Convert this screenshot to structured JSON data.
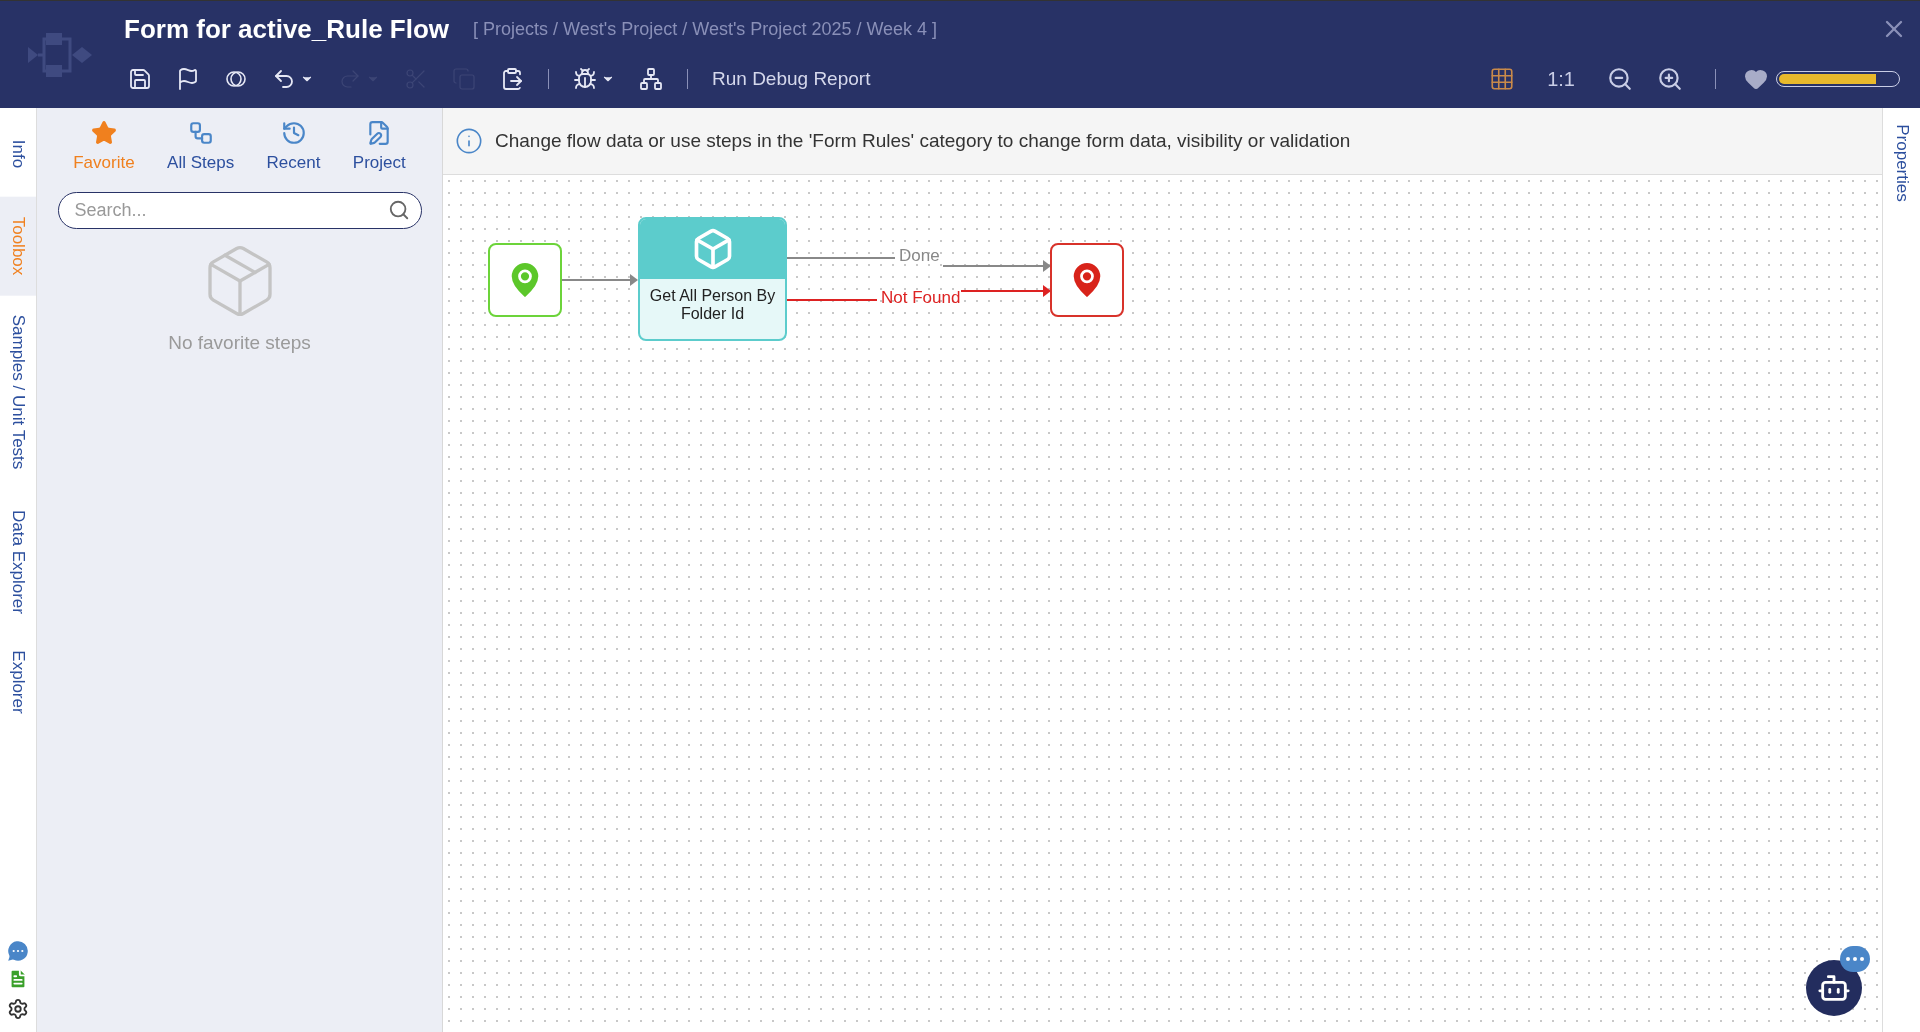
{
  "window": {
    "title": "Form for active_Rule Flow",
    "breadcrumb": "[ Projects / West's Project / West's Project 2025 / Week 4 ]"
  },
  "toolbar": {
    "tools": [
      {
        "kind": "save",
        "disabled": false,
        "dropdown": false
      },
      {
        "kind": "flag",
        "disabled": false,
        "dropdown": false
      },
      {
        "kind": "overlap",
        "disabled": false,
        "dropdown": false
      },
      {
        "kind": "undo",
        "disabled": false,
        "dropdown": true
      },
      {
        "kind": "redo",
        "disabled": true,
        "dropdown": true
      },
      {
        "kind": "cut",
        "disabled": true,
        "dropdown": false
      },
      {
        "kind": "copy",
        "disabled": true,
        "dropdown": false
      },
      {
        "kind": "paste",
        "disabled": false,
        "dropdown": false
      },
      {
        "kind": "separator"
      },
      {
        "kind": "bug",
        "disabled": false,
        "dropdown": true
      },
      {
        "kind": "hierarchy",
        "disabled": false,
        "dropdown": false
      },
      {
        "kind": "separator"
      }
    ],
    "run_debug_report": "Run Debug Report",
    "grid_on": true,
    "zoom_reset": "1:1",
    "memory": {
      "level": 0.82
    }
  },
  "side_tabs": [
    {
      "label": "Info",
      "selected": false
    },
    {
      "label": "Toolbox",
      "selected": true
    },
    {
      "label": "Samples / Unit Tests",
      "selected": false
    },
    {
      "label": "Data Explorer",
      "selected": false
    },
    {
      "label": "Explorer",
      "selected": false
    }
  ],
  "toolbox": {
    "tabs": [
      {
        "kind": "favorite",
        "label": "Favorite",
        "selected": true
      },
      {
        "kind": "all",
        "label": "All Steps",
        "selected": false
      },
      {
        "kind": "recent",
        "label": "Recent",
        "selected": false
      },
      {
        "kind": "project",
        "label": "Project",
        "selected": false
      }
    ],
    "search": {
      "placeholder": "Search..."
    },
    "empty_text": "No favorite steps"
  },
  "info_bar": "Change flow data or use steps in the 'Form Rules' category to change form data, visibility or validation",
  "flow": {
    "nodes": [
      {
        "kind": "start"
      },
      {
        "kind": "step",
        "label": "Get All Person By Folder Id"
      },
      {
        "kind": "end"
      }
    ],
    "connectors": [
      {
        "label": "Done",
        "color": "#888888"
      },
      {
        "label": "Not Found",
        "color": "#dd2222"
      }
    ]
  },
  "right_tabs": [
    {
      "label": "Properties",
      "selected": false
    }
  ]
}
